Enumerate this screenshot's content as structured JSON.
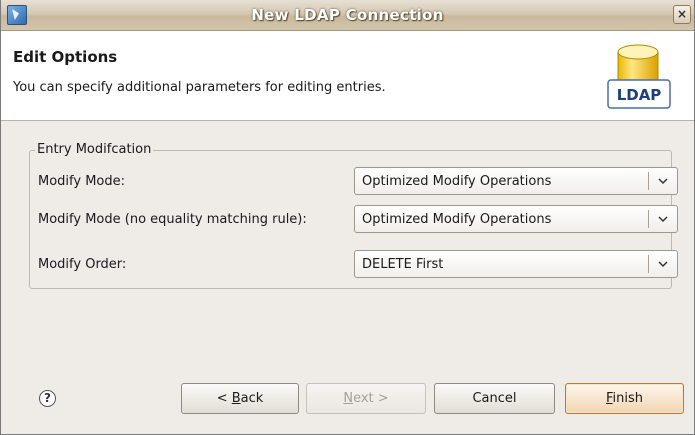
{
  "window": {
    "title": "New LDAP Connection",
    "app_icon": "eclipse-app-icon",
    "close_glyph": "×"
  },
  "header": {
    "title": "Edit Options",
    "description": "You can specify additional parameters for editing entries.",
    "icon": {
      "name": "ldap-database-icon",
      "label": "LDAP"
    }
  },
  "group": {
    "legend": "Entry Modifcation",
    "rows": [
      {
        "label": "Modify Mode:",
        "value": "Optimized Modify Operations"
      },
      {
        "label": "Modify Mode (no equality matching rule):",
        "value": "Optimized Modify Operations"
      },
      {
        "label": "Modify Order:",
        "value": "DELETE First"
      }
    ]
  },
  "footer": {
    "help_glyph": "?",
    "back": {
      "prefix": "< ",
      "mnemonic": "B",
      "rest": "ack"
    },
    "next": {
      "mnemonic": "N",
      "rest": "ext >"
    },
    "cancel": "Cancel",
    "finish": {
      "mnemonic": "F",
      "rest": "inish"
    }
  },
  "colors": {
    "finish_border": "#b67b38",
    "titlebar": "#d6c9b3",
    "dialog_bg": "#efebe7"
  }
}
